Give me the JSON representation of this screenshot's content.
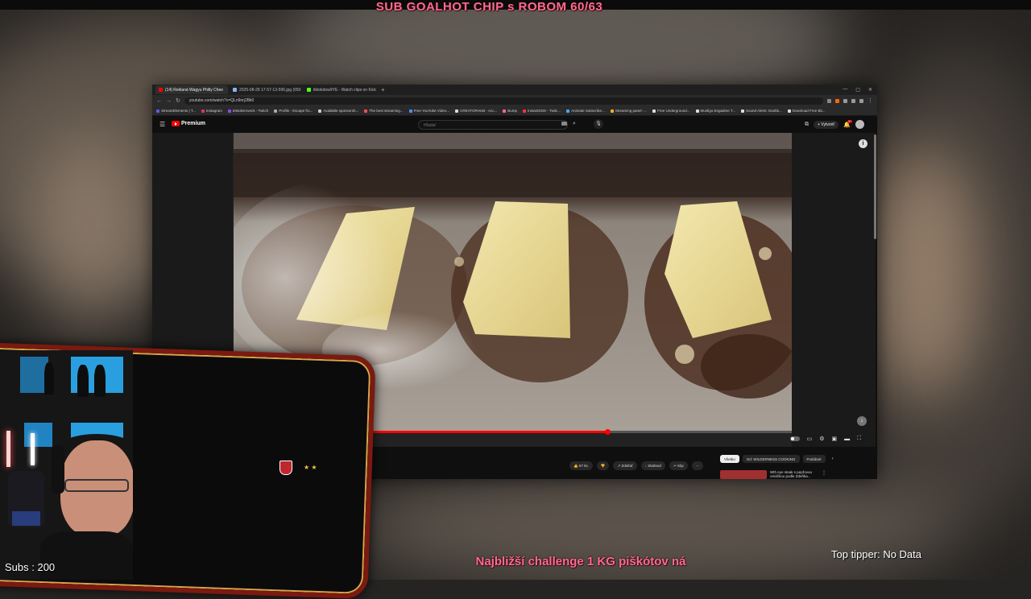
{
  "stream": {
    "top_banner": "SUB GOALHOT CHIP s ROBOM 60/63",
    "bottom_banner": "Najbližší challenge 1 KG piškótov ná",
    "subs": "Subs : 200",
    "top_tipper": "Top tipper: No Data"
  },
  "browser": {
    "tabs": [
      {
        "label": "(14) Reklaná Wagyu Philly Chee",
        "active": true,
        "color": "#ff0000"
      },
      {
        "label": "2025-08-29 17-57-13-596.jpg (650",
        "active": false,
        "color": "#8ab4f8"
      },
      {
        "label": "tiktokdow9YE - Watch clips on Kick",
        "active": false,
        "color": "#53fc18"
      }
    ],
    "new_tab": "+",
    "url": "youtube.com/watch?v=QLn9nrj2Bk0",
    "bookmarks": [
      {
        "label": "StreamElements | T...",
        "color": "#5e5ce6"
      },
      {
        "label": "Instagram",
        "color": "#e1306c"
      },
      {
        "label": "tektokeroveck - Twitch",
        "color": "#9146ff"
      },
      {
        "label": "Profile - Escape fro...",
        "color": "#aaaaaa"
      },
      {
        "label": "Available sponsorsh...",
        "color": "#cccccc"
      },
      {
        "label": "The best streaming...",
        "color": "#ff4d4d"
      },
      {
        "label": "Free YouTube Video...",
        "color": "#4d90fe"
      },
      {
        "label": "CREATORHUB - Acc...",
        "color": "#dddddd"
      },
      {
        "label": "Bump",
        "color": "#ff66aa"
      },
      {
        "label": "InstantDGE - Twitc...",
        "color": "#ff3333"
      },
      {
        "label": "Animate Subscribe...",
        "color": "#44aaff"
      },
      {
        "label": "Streaming panel -...",
        "color": "#ffaa33"
      },
      {
        "label": "Free Underground...",
        "color": "#dddddd"
      },
      {
        "label": "Musfigo Engadme T...",
        "color": "#dddddd"
      },
      {
        "label": "Sound Alerts: Dashb...",
        "color": "#dddddd"
      },
      {
        "label": "Download Free Bit...",
        "color": "#dddddd"
      }
    ]
  },
  "youtube": {
    "logo": "Premium",
    "search_placeholder": "Hľadať",
    "create_label": "+ Vytvoriť",
    "notifications": "9+",
    "progress_fraction": 0.67,
    "actions": [
      {
        "icon": "like-icon",
        "label": "👍 57 tis."
      },
      {
        "icon": "dislike-icon",
        "label": "👎"
      },
      {
        "icon": "share-icon",
        "label": "↗ Zdieľať"
      },
      {
        "icon": "download-icon",
        "label": "↓ Stiahnuť"
      },
      {
        "icon": "clip-icon",
        "label": "✂ Klip"
      },
      {
        "icon": "more-icon",
        "label": "⋯"
      }
    ],
    "chips": [
      {
        "label": "Všetko",
        "active": true
      },
      {
        "label": "Od: WILDERNESS COOKING",
        "active": false
      },
      {
        "label": "Podobné",
        "active": false
      }
    ],
    "recommendation": "Wth eye steak s pepřovou omáčkou podle Zdeňka..."
  }
}
